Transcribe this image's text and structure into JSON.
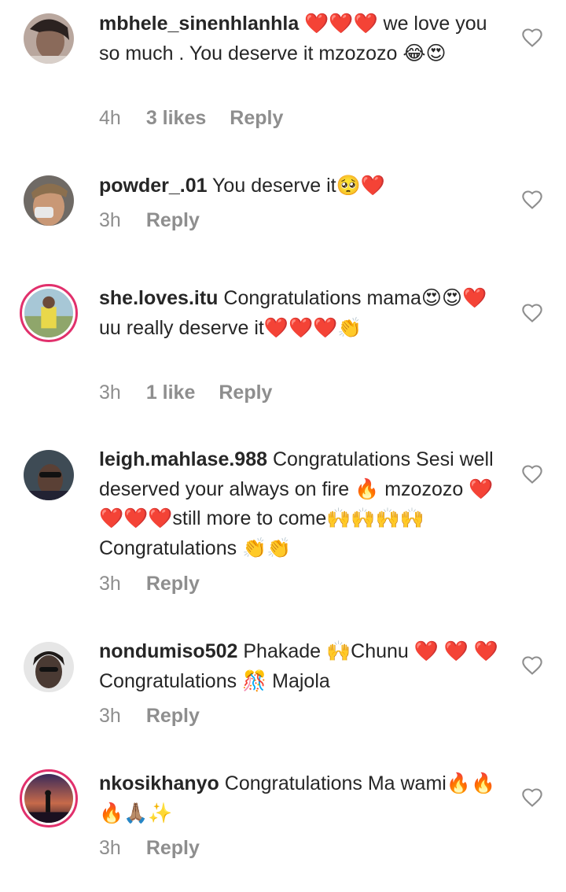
{
  "comments": [
    {
      "username": "mbhele_sinenhlanhla",
      "text": " ❤️❤️❤️ we love you so much . You deserve it mzozozo 😂😍",
      "time": "4h",
      "likes": "3 likes",
      "reply": "Reply"
    },
    {
      "username": "powder_.01",
      "text": " You deserve it🥺❤️",
      "time": "3h",
      "likes": "",
      "reply": "Reply"
    },
    {
      "username": "she.loves.itu",
      "text": " Congratulations mama😍😍❤️ uu really deserve it❤️❤️❤️👏",
      "time": "3h",
      "likes": "1 like",
      "reply": "Reply"
    },
    {
      "username": "leigh.mahlase.988",
      "text": " Congratulations Sesi well deserved your  always  on fire 🔥 mzozozo ❤️❤️❤️❤️still more to come🙌🙌🙌🙌Congratulations 👏👏",
      "time": "3h",
      "likes": "",
      "reply": "Reply"
    },
    {
      "username": "nondumiso502",
      "text": " Phakade 🙌Chunu ❤️ ❤️ ❤️ Congratulations 🎊 Majola",
      "time": "3h",
      "likes": "",
      "reply": "Reply"
    },
    {
      "username": "nkosikhanyo",
      "text": " Congratulations Ma wami🔥🔥🔥🙏🏽✨",
      "time": "3h",
      "likes": "",
      "reply": "Reply"
    }
  ],
  "icons": {
    "like": "heart-outline-icon",
    "avatar": "profile-photo"
  },
  "colors": {
    "text": "#262626",
    "meta": "#8e8e8e",
    "story_ring": "#e1306c"
  }
}
